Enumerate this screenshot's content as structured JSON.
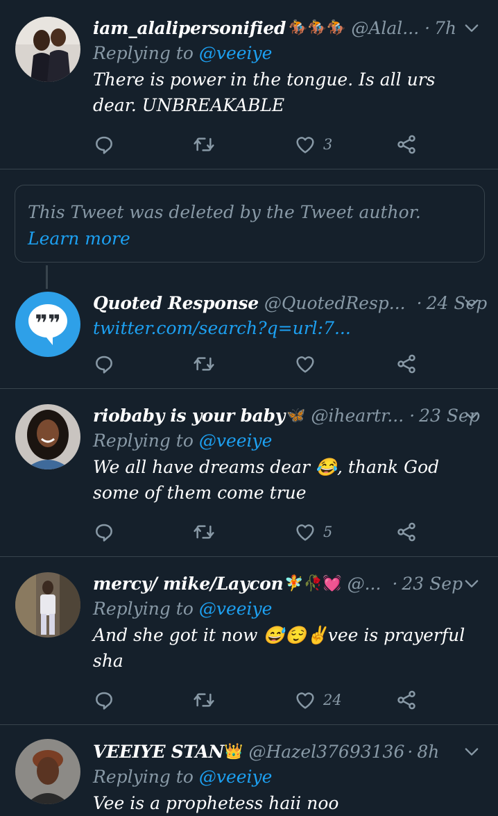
{
  "tweets": [
    {
      "name": "iam_alalipersonified",
      "emoji": "🏇🏇🏇",
      "handle": "@Alal...",
      "time": "7h",
      "replying_prefix": "Replying to",
      "replying_to": "@veeiye",
      "text": "There is power in the tongue. Is all urs dear. UNBREAKABLE",
      "likes": "3"
    },
    {
      "name": "Quoted Response",
      "emoji": "",
      "handle": "@QuotedResp...",
      "time": "24 Sep",
      "link": "twitter.com/search?q=url:7...",
      "likes": ""
    },
    {
      "name": "riobaby is your baby",
      "emoji": "🦋",
      "handle": "@iheartr...",
      "time": "23 Sep",
      "replying_prefix": "Replying to",
      "replying_to": "@veeiye",
      "text": "We all have dreams dear 😂, thank God some of them come true",
      "likes": "5"
    },
    {
      "name": "mercy/ mike/Laycon",
      "emoji": "🧚🥀💓",
      "handle": "@...",
      "time": "23 Sep",
      "replying_prefix": "Replying to",
      "replying_to": "@veeiye",
      "text": "And she got it now 😅😌✌vee is prayerful sha",
      "likes": "24"
    },
    {
      "name": "VEEIYE STAN",
      "emoji": "👑",
      "handle": "@Hazel37693136",
      "time": "8h",
      "replying_prefix": "Replying to",
      "replying_to": "@veeiye",
      "text": "Vee is a prophetess haii noo"
    }
  ],
  "deleted_notice": {
    "text": "This Tweet was deleted by the Tweet author.",
    "link": "Learn more"
  },
  "quote_icon": "❞❞",
  "icons": [
    "reply-icon",
    "retweet-icon",
    "like-icon",
    "share-icon",
    "chevron-down-icon",
    "quote-bubble-icon"
  ],
  "colors": {
    "background": "#15202b",
    "divider": "#38444d",
    "secondary_text": "#8899a6",
    "accent": "#1da1f2"
  }
}
